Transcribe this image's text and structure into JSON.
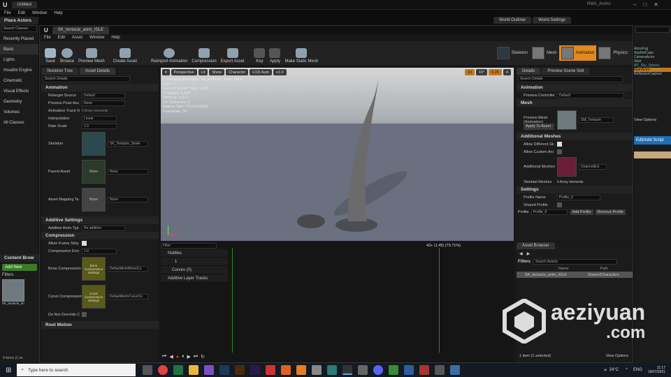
{
  "outer_menu": [
    "File",
    "Edit",
    "Window",
    "Help"
  ],
  "outer_title": "Untitled",
  "outer_right": [
    "World Outliner",
    "World Settings"
  ],
  "outer_right_title": "RWA_Anims",
  "place_actors": {
    "title": "Place Actors",
    "search_placeholder": "Search Classes",
    "categories": [
      "Recently Placed",
      "Basic",
      "Lights",
      "Houdini Engine",
      "Cinematic",
      "Visual Effects",
      "Geometry",
      "Volumes",
      "All Classes"
    ]
  },
  "editor_tab": "SK_tentacle_anim_IDLE",
  "editor_menu": [
    "File",
    "Edit",
    "Asset",
    "Window",
    "Help"
  ],
  "toolbar": [
    "Save",
    "Browse",
    "Preview Mesh",
    "Create Asset",
    "Reimport Animation",
    "Compression",
    "Export Asset",
    "Key",
    "Apply",
    "Make Static Mesh"
  ],
  "modes": [
    "Skeleton",
    "Mesh",
    "Animation",
    "Physics"
  ],
  "left_tabs": [
    "Skeleton Tree",
    "Asset Details"
  ],
  "left_search": "Search Details",
  "animation_props": [
    {
      "label": "Retarget Source",
      "value": "Default"
    },
    {
      "label": "Preview Pose Ass",
      "value": "None"
    },
    {
      "label": "Animation Track N",
      "value": "0 Array elements"
    },
    {
      "label": "Interpolation",
      "value": "Linear"
    },
    {
      "label": "Rate Scale",
      "value": "1.0"
    }
  ],
  "skeleton_label": "Skeleton",
  "skeleton_value": "SK_Tentacle_Skele",
  "parent_asset_label": "Parent Asset",
  "parent_asset_value": "None",
  "parent_thumb": "None",
  "mapping_label": "Asset Mapping Ta",
  "mapping_value": "None",
  "mapping_thumb": "None",
  "sections_left": [
    "Animation",
    "Additive Settings",
    "Compression",
    "Root Motion"
  ],
  "additive": {
    "label": "Additive Anim Typ",
    "value": "No additive"
  },
  "compression": [
    {
      "label": "Allow Frame Strip",
      "value": ""
    },
    {
      "label": "Compression Erro",
      "value": "1.0"
    },
    {
      "label": "Bone Compression",
      "value": "DefaultAnimBoneCo",
      "thumb": "Bone Compression Settings"
    },
    {
      "label": "Curve Compression",
      "value": "DefaultAnimCurveCo",
      "thumb": "Curve Compression Settings"
    },
    {
      "label": "Do Not Override C",
      "value": ""
    }
  ],
  "viewport": {
    "buttons": [
      "Perspective",
      "Lit",
      "Show",
      "Character",
      "LOD Auto",
      "x1.0"
    ],
    "info": [
      "Previewing Animation SK_tentacle_anim_IDLE",
      "LOD: 0",
      "Current Screen Size: 1.081",
      "Triangles: 5,424",
      "Vertices: 4,871",
      "UV Channels: 1",
      "Approx Size: 111x112x320",
      "Framerate: 30"
    ],
    "right_vals": [
      "10",
      "10°",
      "0.25",
      "4"
    ]
  },
  "timeline": {
    "filter": "Filter",
    "rows": [
      "Notifies",
      "1",
      "Curves (0)",
      "Additive Layer Tracks"
    ],
    "frame": "43+ (1.45) (73.71%)"
  },
  "details": {
    "tabs": [
      "Details",
      "Preview Scene Sett"
    ],
    "search": "Search Details",
    "animation_label": "Preview Controller",
    "animation_value": "Default",
    "preview_mesh_label": "Preview Mesh (Animation)",
    "preview_mesh_value": "SM_Tentacle",
    "apply_btn": "Apply To Asset",
    "add_mesh": [
      "Allow Different Sk",
      "Allow Custom Ani",
      "Additional Meshes",
      "Skeletal Meshes"
    ],
    "additional_value": "UnannotExt",
    "skeletal_value": "0 Array elements",
    "profile_name": "Profile Name",
    "profile_value": "Profile_0",
    "shared_profile": "Shared Profile",
    "profile_label": "Profile",
    "profile_select": "Profile_0",
    "add_profile": "Add Profile",
    "remove_profile": "Remove Profile",
    "sections": [
      "Animation",
      "Mesh",
      "Additional Meshes",
      "Settings"
    ]
  },
  "asset_browser": {
    "title": "Asset Browser",
    "filters": "Filters",
    "search": "Search Assets",
    "col_name": "Name",
    "col_path": "Path",
    "item_name": "SK_tentacle_anim_IDLE",
    "item_path": "/Game/Characters",
    "status": "1 item (1 selected)",
    "view_options": "View Options"
  },
  "content_browser": {
    "title": "Content Brow",
    "add_new": "Add New",
    "filters": "Filters",
    "item": "SK_tentacle_anim_IDLE",
    "status": "4 items (1 se"
  },
  "far_right": [
    "AtmoFog",
    "SkyRefCube",
    "CameraActor",
    "Start",
    "BP_Sky_Sphere",
    "MainActor",
    "ReflectionCapture"
  ],
  "far_right_view": "View Options",
  "far_right_btn": "Edit/Add Script",
  "taskbar": {
    "search": "Type here to search",
    "temp": "24°C",
    "lang": "ENG",
    "time": "11:17",
    "date": "18/07/2021"
  },
  "watermark": {
    "brand": "aeziyuan",
    "domain": ".com"
  }
}
